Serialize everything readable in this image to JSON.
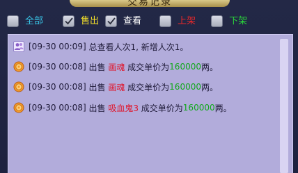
{
  "window": {
    "title": "交易记录"
  },
  "filters": [
    {
      "label": "全部",
      "checked": false,
      "color": "#39c6e8"
    },
    {
      "label": "售出",
      "checked": true,
      "color": "#f6e22a"
    },
    {
      "label": "查看",
      "checked": true,
      "color": "#ffffff"
    },
    {
      "label": "上架",
      "checked": false,
      "color": "#e8282a"
    },
    {
      "label": "下架",
      "checked": false,
      "color": "#2ad63a"
    }
  ],
  "log": {
    "entries": [
      {
        "icon": "users-icon",
        "time": "[09-30 00:09]",
        "text": "总查看人次1, 新增人次1。"
      },
      {
        "icon": "coin-icon",
        "time": "[09-30 00:08]",
        "action": "出售",
        "item": "画魂",
        "mid": "成交单价为",
        "price": "160000",
        "unit": "两。"
      },
      {
        "icon": "coin-icon",
        "time": "[09-30 00:08]",
        "action": "出售",
        "item": "画魂",
        "mid": "成交单价为",
        "price": "160000",
        "unit": "两。"
      },
      {
        "icon": "coin-icon",
        "time": "[09-30 00:08]",
        "action": "出售",
        "item": "吸血鬼3",
        "mid": "成交单价为",
        "price": "160000",
        "unit": "两。"
      }
    ]
  }
}
